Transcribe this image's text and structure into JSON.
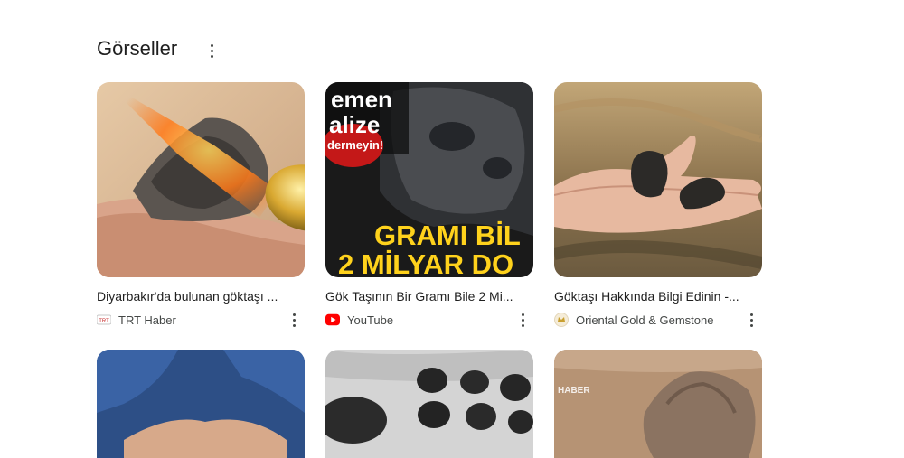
{
  "section": {
    "title": "Görseller",
    "more_icon": "more-vert-icon"
  },
  "cards": [
    {
      "title": "Diyarbakır'da bulunan göktaşı ...",
      "source": "TRT Haber",
      "favicon_text": "TRT"
    },
    {
      "title": "Gök Taşının Bir Gramı Bile 2 Mi...",
      "source": "YouTube",
      "overlay_lines": [
        "emen",
        "alize",
        "dermeyin!",
        "GRAMI BİL",
        "2 MİLYAR DO"
      ]
    },
    {
      "title": "Göktaşı Hakkında Bilgi Edinin -...",
      "source": "Oriental Gold & Gemstone"
    },
    {
      "title": "",
      "source": ""
    },
    {
      "title": "",
      "source": ""
    },
    {
      "title": "",
      "source": "",
      "watermark": "HABER"
    }
  ],
  "colors": {
    "youtube_red": "#ff0000",
    "text": "#1f1f1f",
    "muted": "#444746"
  }
}
